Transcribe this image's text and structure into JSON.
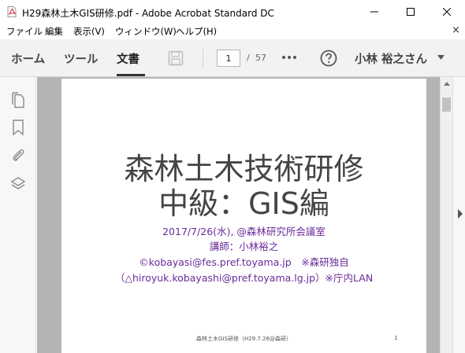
{
  "window": {
    "title": "H29森林土木GIS研修.pdf - Adobe Acrobat Standard DC",
    "minimize_icon": "minimize-icon",
    "maximize_icon": "maximize-icon",
    "close_icon": "close-icon"
  },
  "menu": {
    "items": [
      "ファイル",
      "編集",
      "表示(V)",
      "ウィンドウ(W)",
      "ヘルプ(H)"
    ],
    "close_glyph": "×"
  },
  "toolbar": {
    "tabs": [
      "ホーム",
      "ツール",
      "文書"
    ],
    "active_tab": "文書",
    "page_current": "1",
    "page_separator": "/",
    "page_total": "57",
    "user_name": "小林 裕之さん"
  },
  "slide": {
    "title_line1": "森林土木技術研修",
    "title_line2": "中級：GIS編",
    "lines": [
      "2017/7/26(水), @森林研究所会議室",
      "講師：小林裕之",
      "©kobayasi@fes.pref.toyama.jp　※森研独自",
      "（△hiroyuk.kobayashi@pref.toyama.lg.jp）※庁内LAN"
    ],
    "footer": "森林土木GIS研修（H29.7.26@森研）",
    "page_number": "1"
  },
  "colors": {
    "accent_text": "#6a2a9a",
    "pdf_icon": "#d4232b",
    "doc_background": "#b4b4b4"
  }
}
